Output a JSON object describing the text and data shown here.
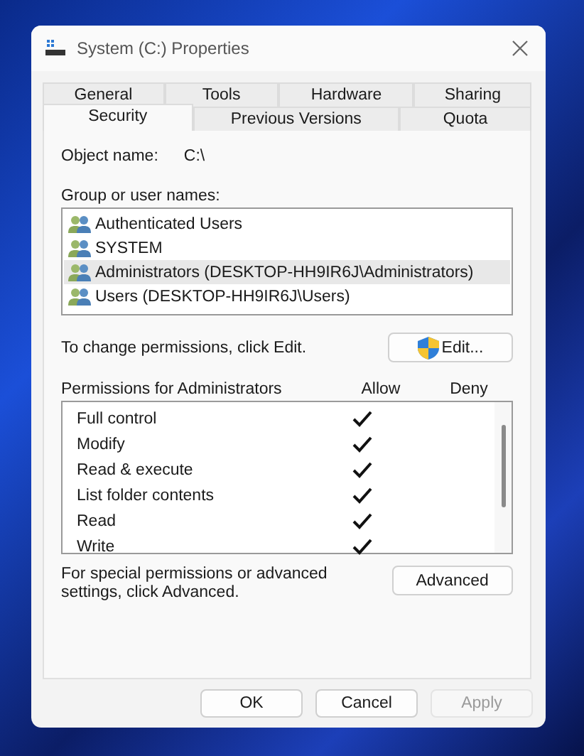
{
  "window": {
    "title": "System (C:) Properties"
  },
  "tab_rows": [
    [
      {
        "label": "General",
        "selected": false
      },
      {
        "label": "Tools",
        "selected": false
      },
      {
        "label": "Hardware",
        "selected": false
      },
      {
        "label": "Sharing",
        "selected": false
      }
    ],
    [
      {
        "label": "Security",
        "selected": true
      },
      {
        "label": "Previous Versions",
        "selected": false
      },
      {
        "label": "Quota",
        "selected": false
      }
    ]
  ],
  "object_name": {
    "label": "Object name:",
    "value": "C:\\"
  },
  "groups": {
    "label": "Group or user names:",
    "items": [
      {
        "name": "Authenticated Users",
        "selected": false
      },
      {
        "name": "SYSTEM",
        "selected": false
      },
      {
        "name": "Administrators (DESKTOP-HH9IR6J\\Administrators)",
        "selected": true
      },
      {
        "name": "Users (DESKTOP-HH9IR6J\\Users)",
        "selected": false
      }
    ]
  },
  "change_hint": "To change permissions, click Edit.",
  "edit_button": "Edit...",
  "permissions": {
    "title": "Permissions for Administrators",
    "allow_header": "Allow",
    "deny_header": "Deny",
    "rows": [
      {
        "name": "Full control",
        "allow": true,
        "deny": false
      },
      {
        "name": "Modify",
        "allow": true,
        "deny": false
      },
      {
        "name": "Read & execute",
        "allow": true,
        "deny": false
      },
      {
        "name": "List folder contents",
        "allow": true,
        "deny": false
      },
      {
        "name": "Read",
        "allow": true,
        "deny": false
      },
      {
        "name": "Write",
        "allow": true,
        "deny": false
      }
    ]
  },
  "advanced_hint": "For special permissions or advanced settings, click Advanced.",
  "advanced_button": "Advanced",
  "buttons": [
    {
      "label": "OK",
      "disabled": false
    },
    {
      "label": "Cancel",
      "disabled": false
    },
    {
      "label": "Apply",
      "disabled": true
    }
  ]
}
